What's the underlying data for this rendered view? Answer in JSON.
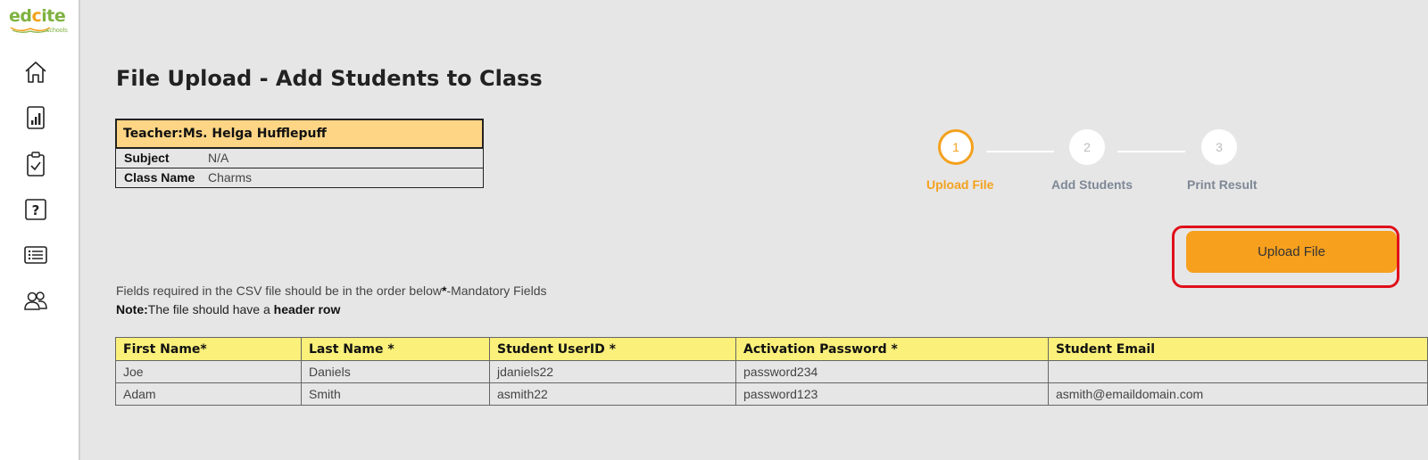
{
  "brand": {
    "name_part1": "ed",
    "name_part2": "c",
    "name_part3": "ite",
    "tagline": "schools"
  },
  "sidebar": {
    "items": [
      {
        "icon": "home-icon"
      },
      {
        "icon": "reports-icon"
      },
      {
        "icon": "clipboard-check-icon"
      },
      {
        "icon": "question-icon"
      },
      {
        "icon": "list-icon"
      },
      {
        "icon": "users-icon"
      }
    ]
  },
  "page": {
    "title": "File Upload - Add Students to Class"
  },
  "class_info": {
    "teacher_label": "Teacher:",
    "teacher_name": "Ms. Helga Hufflepuff",
    "subject_label": "Subject",
    "subject_value": "N/A",
    "class_label": "Class Name",
    "class_value": "Charms"
  },
  "stepper": {
    "steps": [
      {
        "number": "1",
        "label": "Upload File",
        "active": true
      },
      {
        "number": "2",
        "label": "Add Students",
        "active": false
      },
      {
        "number": "3",
        "label": "Print Result",
        "active": false
      }
    ]
  },
  "upload_button": {
    "label": "Upload File"
  },
  "notes": {
    "line1_text": "Fields required in the CSV file should be in the order below",
    "line1_star": "*",
    "line1_suffix": "-Mandatory Fields",
    "line2_label": "Note:",
    "line2_text": "The file should have a ",
    "line2_bold": "header row"
  },
  "csv_table": {
    "headers": [
      "First Name*",
      "Last Name *",
      "Student UserID *",
      "Activation Password *",
      "Student Email"
    ],
    "rows": [
      [
        "Joe",
        "Daniels",
        "jdaniels22",
        "password234",
        ""
      ],
      [
        "Adam",
        "Smith",
        "asmith22",
        "password123",
        "asmith@emaildomain.com"
      ]
    ]
  },
  "colors": {
    "accent": "#f7a01e",
    "highlight_border": "#e0101b",
    "teacher_header_bg": "#fdd585",
    "table_header_bg": "#faf07a",
    "page_bg": "#e6e6e6"
  }
}
